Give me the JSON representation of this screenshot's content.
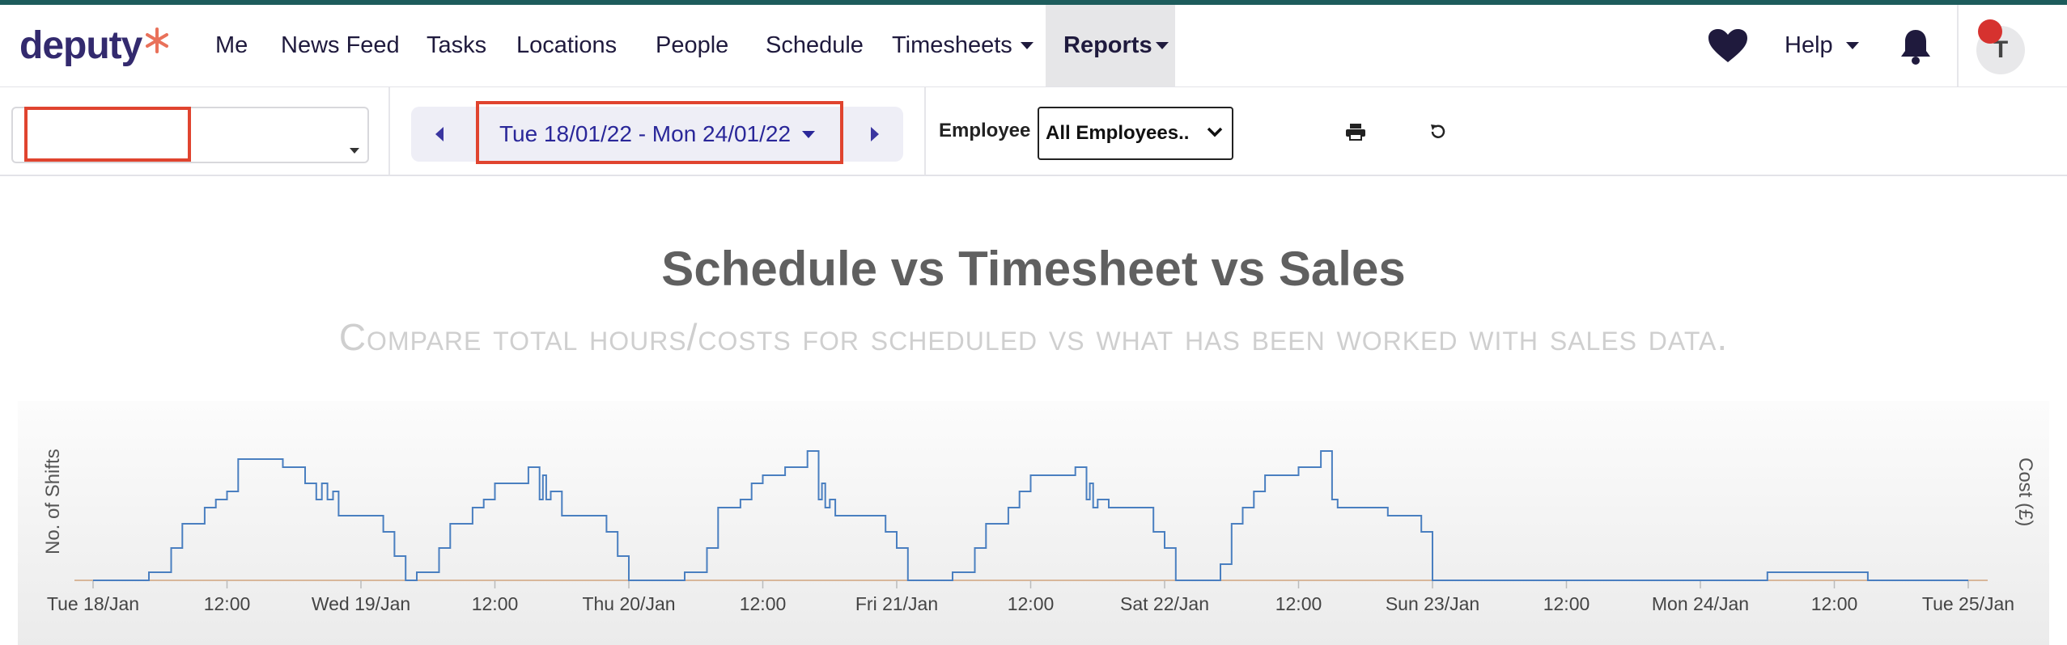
{
  "nav": {
    "logo_text": "deputy",
    "items": [
      {
        "label": "Me"
      },
      {
        "label": "News Feed"
      },
      {
        "label": "Tasks"
      },
      {
        "label": "Locations"
      },
      {
        "label": "People"
      },
      {
        "label": "Schedule"
      },
      {
        "label": "Timesheets"
      },
      {
        "label": "Reports"
      }
    ],
    "help_label": "Help",
    "avatar_initial": "T"
  },
  "toolbar": {
    "location_value": "",
    "date_range": "Tue 18/01/22 - Mon 24/01/22",
    "employee_label": "Employee",
    "employee_select": "All Employees..",
    "employee_options": [
      "All Employees.."
    ]
  },
  "report": {
    "title": "Schedule vs Timesheet vs Sales",
    "subtitle": "Compare total hours/costs for scheduled vs what has been worked with sales data."
  },
  "chart_data": {
    "type": "line",
    "title": "Schedule vs Timesheet vs Sales",
    "ylabel": "No. of Shifts",
    "y2label": "Cost (£)",
    "x_tick_labels": [
      "Tue 18/Jan",
      "12:00",
      "Wed 19/Jan",
      "12:00",
      "Thu 20/Jan",
      "12:00",
      "Fri 21/Jan",
      "12:00",
      "Sat 22/Jan",
      "12:00",
      "Sun 23/Jan",
      "12:00",
      "Mon 24/Jan",
      "12:00",
      "Tue 25/Jan"
    ],
    "x_unit": "hours since Tue 18/Jan 00:00",
    "x_range": [
      0,
      168
    ],
    "y_range": [
      0,
      16
    ],
    "series": [
      {
        "name": "",
        "color": "#4a7fc0",
        "step": true,
        "points": [
          [
            0,
            0
          ],
          [
            5,
            0
          ],
          [
            5,
            1
          ],
          [
            7,
            1
          ],
          [
            7,
            4
          ],
          [
            8,
            4
          ],
          [
            8,
            7
          ],
          [
            10,
            7
          ],
          [
            10,
            9
          ],
          [
            11,
            9
          ],
          [
            11,
            10
          ],
          [
            12,
            10
          ],
          [
            12,
            11
          ],
          [
            13,
            11
          ],
          [
            13,
            15
          ],
          [
            17,
            15
          ],
          [
            17,
            14
          ],
          [
            19,
            14
          ],
          [
            19,
            12
          ],
          [
            20,
            12
          ],
          [
            20,
            10
          ],
          [
            20.5,
            10
          ],
          [
            20.5,
            12
          ],
          [
            21,
            12
          ],
          [
            21,
            10
          ],
          [
            21.5,
            10
          ],
          [
            21.5,
            11
          ],
          [
            22,
            11
          ],
          [
            22,
            8
          ],
          [
            26,
            8
          ],
          [
            26,
            6
          ],
          [
            27,
            6
          ],
          [
            27,
            3
          ],
          [
            28,
            3
          ],
          [
            28,
            0
          ],
          [
            29,
            0
          ],
          [
            29,
            1
          ],
          [
            31,
            1
          ],
          [
            31,
            4
          ],
          [
            32,
            4
          ],
          [
            32,
            7
          ],
          [
            34,
            7
          ],
          [
            34,
            9
          ],
          [
            35,
            9
          ],
          [
            35,
            10
          ],
          [
            36,
            10
          ],
          [
            36,
            12
          ],
          [
            39,
            12
          ],
          [
            39,
            14
          ],
          [
            40,
            14
          ],
          [
            40,
            10
          ],
          [
            40.3,
            10
          ],
          [
            40.3,
            13
          ],
          [
            40.6,
            13
          ],
          [
            40.6,
            10
          ],
          [
            41,
            10
          ],
          [
            41,
            11
          ],
          [
            42,
            11
          ],
          [
            42,
            8
          ],
          [
            46,
            8
          ],
          [
            46,
            6
          ],
          [
            47,
            6
          ],
          [
            47,
            3
          ],
          [
            48,
            3
          ],
          [
            48,
            0
          ],
          [
            53,
            0
          ],
          [
            53,
            1
          ],
          [
            55,
            1
          ],
          [
            55,
            4
          ],
          [
            56,
            4
          ],
          [
            56,
            9
          ],
          [
            58,
            9
          ],
          [
            58,
            10
          ],
          [
            59,
            10
          ],
          [
            59,
            12
          ],
          [
            60,
            12
          ],
          [
            60,
            13
          ],
          [
            62,
            13
          ],
          [
            62,
            14
          ],
          [
            64,
            14
          ],
          [
            64,
            16
          ],
          [
            65,
            16
          ],
          [
            65,
            10
          ],
          [
            65.3,
            10
          ],
          [
            65.3,
            12
          ],
          [
            65.6,
            12
          ],
          [
            65.6,
            9
          ],
          [
            66,
            9
          ],
          [
            66,
            10
          ],
          [
            66.5,
            10
          ],
          [
            66.5,
            8
          ],
          [
            71,
            8
          ],
          [
            71,
            6
          ],
          [
            72,
            6
          ],
          [
            72,
            4
          ],
          [
            73,
            4
          ],
          [
            73,
            0
          ],
          [
            77,
            0
          ],
          [
            77,
            1
          ],
          [
            79,
            1
          ],
          [
            79,
            4
          ],
          [
            80,
            4
          ],
          [
            80,
            7
          ],
          [
            82,
            7
          ],
          [
            82,
            9
          ],
          [
            83,
            9
          ],
          [
            83,
            11
          ],
          [
            84,
            11
          ],
          [
            84,
            13
          ],
          [
            88,
            13
          ],
          [
            88,
            14
          ],
          [
            89,
            14
          ],
          [
            89,
            10
          ],
          [
            89.3,
            10
          ],
          [
            89.3,
            12
          ],
          [
            89.6,
            12
          ],
          [
            89.6,
            9
          ],
          [
            90,
            9
          ],
          [
            90,
            10
          ],
          [
            91,
            10
          ],
          [
            91,
            9
          ],
          [
            95,
            9
          ],
          [
            95,
            6
          ],
          [
            96,
            6
          ],
          [
            96,
            4
          ],
          [
            97,
            4
          ],
          [
            97,
            0
          ],
          [
            101,
            0
          ],
          [
            101,
            2
          ],
          [
            102,
            2
          ],
          [
            102,
            7
          ],
          [
            103,
            7
          ],
          [
            103,
            9
          ],
          [
            104,
            9
          ],
          [
            104,
            11
          ],
          [
            105,
            11
          ],
          [
            105,
            13
          ],
          [
            108,
            13
          ],
          [
            108,
            14
          ],
          [
            110,
            14
          ],
          [
            110,
            16
          ],
          [
            111,
            16
          ],
          [
            111,
            10
          ],
          [
            111.5,
            10
          ],
          [
            111.5,
            9
          ],
          [
            112,
            9
          ],
          [
            112,
            9
          ],
          [
            113,
            9
          ],
          [
            113,
            9
          ],
          [
            116,
            9
          ],
          [
            116,
            8
          ],
          [
            119,
            8
          ],
          [
            119,
            6
          ],
          [
            120,
            6
          ],
          [
            120,
            0
          ],
          [
            150,
            0
          ],
          [
            150,
            1
          ],
          [
            159,
            1
          ],
          [
            159,
            0
          ],
          [
            168,
            0
          ]
        ]
      }
    ],
    "zero_line_color": "#d8b79a",
    "grid": false
  }
}
